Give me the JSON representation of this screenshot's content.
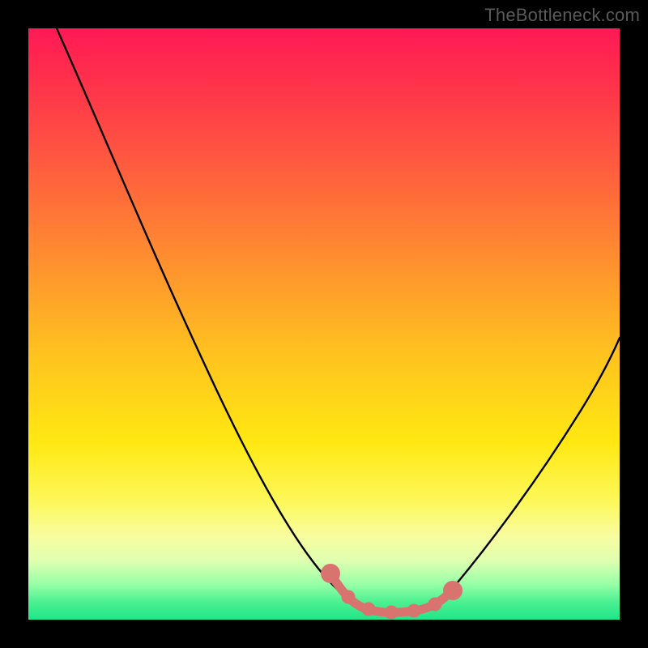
{
  "watermark": "TheBottleneck.com",
  "chart_data": {
    "type": "line",
    "title": "",
    "xlabel": "",
    "ylabel": "",
    "xlim": [
      0,
      100
    ],
    "ylim": [
      0,
      100
    ],
    "grid": false,
    "legend": false,
    "background_gradient": {
      "direction": "vertical",
      "stops": [
        {
          "pos": 0.0,
          "color": "#ff1a55"
        },
        {
          "pos": 0.22,
          "color": "#ff5840"
        },
        {
          "pos": 0.55,
          "color": "#ffc21f"
        },
        {
          "pos": 0.8,
          "color": "#fdf85a"
        },
        {
          "pos": 0.94,
          "color": "#98ffa8"
        },
        {
          "pos": 1.0,
          "color": "#1ee689"
        }
      ]
    },
    "series": [
      {
        "name": "bottleneck-curve",
        "color": "#000000",
        "x": [
          0,
          5,
          10,
          15,
          20,
          25,
          30,
          35,
          40,
          45,
          50,
          55,
          60,
          63,
          66,
          70,
          75,
          80,
          85,
          90,
          95,
          100
        ],
        "values": [
          100,
          93,
          86,
          78,
          70,
          62,
          54,
          46,
          38,
          30,
          22,
          14,
          7,
          4,
          3,
          3,
          6,
          12,
          20,
          29,
          38,
          48
        ]
      },
      {
        "name": "highlight",
        "color": "#d9736f",
        "style": "thick-dots",
        "x": [
          52,
          55,
          58,
          61,
          64,
          67,
          70,
          73
        ],
        "values": [
          11,
          7,
          5,
          4,
          3,
          3,
          4,
          6
        ]
      }
    ],
    "annotations": []
  }
}
